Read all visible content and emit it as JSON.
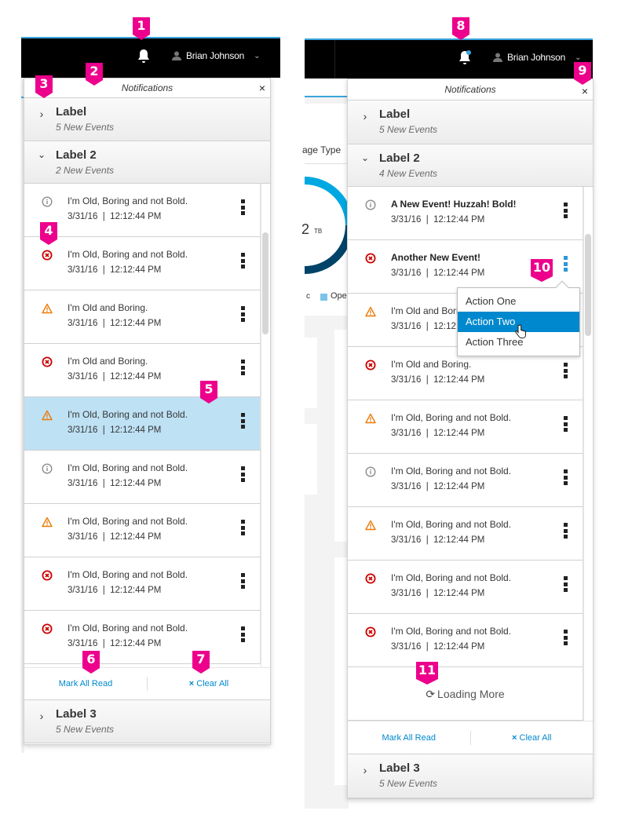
{
  "user": {
    "name": "Brian Johnson"
  },
  "drawer": {
    "title": "Notifications",
    "close_label": "×",
    "footer": {
      "mark_all_read": "Mark All Read",
      "clear_all": "Clear All",
      "clear_icon": "×"
    },
    "loading_more": "Loading More"
  },
  "left": {
    "groups": [
      {
        "title": "Label",
        "subtitle": "5 New Events",
        "expanded": false
      },
      {
        "title": "Label 2",
        "subtitle": "2 New Events",
        "expanded": true
      },
      {
        "title": "Label 3",
        "subtitle": "5 New Events",
        "expanded": false
      }
    ],
    "items": [
      {
        "type": "info",
        "message": "I'm Old, Boring and not Bold.",
        "timestamp": "3/31/16  |  12:12:44 PM",
        "bold": false,
        "selected": false
      },
      {
        "type": "error",
        "message": "I'm Old, Boring and not Bold.",
        "timestamp": "3/31/16  |  12:12:44 PM",
        "bold": false,
        "selected": false
      },
      {
        "type": "warning",
        "message": "I'm Old and Boring.",
        "timestamp": "3/31/16  |  12:12:44 PM",
        "bold": false,
        "selected": false
      },
      {
        "type": "error",
        "message": "I'm Old and Boring.",
        "timestamp": "3/31/16  |  12:12:44 PM",
        "bold": false,
        "selected": false
      },
      {
        "type": "warning",
        "message": "I'm Old, Boring and not Bold.",
        "timestamp": "3/31/16  |  12:12:44 PM",
        "bold": false,
        "selected": true
      },
      {
        "type": "info",
        "message": "I'm Old, Boring and not Bold.",
        "timestamp": "3/31/16  |  12:12:44 PM",
        "bold": false,
        "selected": false
      },
      {
        "type": "warning",
        "message": "I'm Old, Boring and not Bold.",
        "timestamp": "3/31/16  |  12:12:44 PM",
        "bold": false,
        "selected": false
      },
      {
        "type": "error",
        "message": "I'm Old, Boring and not Bold.",
        "timestamp": "3/31/16  |  12:12:44 PM",
        "bold": false,
        "selected": false
      },
      {
        "type": "error",
        "message": "I'm Old, Boring and not Bold.",
        "timestamp": "3/31/16  |  12:12:44 PM",
        "bold": false,
        "selected": false
      }
    ]
  },
  "right": {
    "bell_has_unread": true,
    "groups": [
      {
        "title": "Label",
        "subtitle": "5 New Events",
        "expanded": false
      },
      {
        "title": "Label 2",
        "subtitle": "4 New Events",
        "expanded": true
      },
      {
        "title": "Label 3",
        "subtitle": "5 New Events",
        "expanded": false
      }
    ],
    "items": [
      {
        "type": "info",
        "message": "A New Event! Huzzah! Bold!",
        "timestamp": "3/31/16  |  12:12:44 PM",
        "bold": true
      },
      {
        "type": "error",
        "message": "Another New Event!",
        "timestamp": "3/31/16  |  12:12:44 PM",
        "bold": true,
        "menu_open": true
      },
      {
        "type": "warning",
        "message": "I'm Old and Boring.",
        "timestamp": "3/31/16  |  12:12:44 PM",
        "bold": false
      },
      {
        "type": "error",
        "message": "I'm Old and Boring.",
        "timestamp": "3/31/16  |  12:12:44 PM",
        "bold": false
      },
      {
        "type": "warning",
        "message": "I'm Old, Boring and not Bold.",
        "timestamp": "3/31/16  |  12:12:44 PM",
        "bold": false
      },
      {
        "type": "info",
        "message": "I'm Old, Boring and not Bold.",
        "timestamp": "3/31/16  |  12:12:44 PM",
        "bold": false
      },
      {
        "type": "warning",
        "message": "I'm Old, Boring and not Bold.",
        "timestamp": "3/31/16  |  12:12:44 PM",
        "bold": false
      },
      {
        "type": "error",
        "message": "I'm Old, Boring and not Bold.",
        "timestamp": "3/31/16  |  12:12:44 PM",
        "bold": false
      },
      {
        "type": "error",
        "message": "I'm Old, Boring and not Bold.",
        "timestamp": "3/31/16  |  12:12:44 PM",
        "bold": false
      }
    ],
    "action_menu": [
      {
        "label": "Action One",
        "hover": false
      },
      {
        "label": "Action Two",
        "hover": true
      },
      {
        "label": "Action Three",
        "hover": false
      }
    ],
    "background": {
      "card_title_fragment": "age Type",
      "donut_unit": "TB",
      "donut_value_fragment": "2",
      "legend_fragment": "Ope",
      "legend_left_fragment": "c"
    }
  },
  "callouts": [
    "1",
    "2",
    "3",
    "4",
    "5",
    "6",
    "7",
    "8",
    "9",
    "10",
    "11"
  ],
  "colors": {
    "info": "#8b8d8f",
    "error": "#cc0000",
    "warning": "#ec7a08",
    "link": "#0088ce",
    "selected": "#bee1f4",
    "callout": "#ec008c",
    "accent": "#39a5dc"
  }
}
